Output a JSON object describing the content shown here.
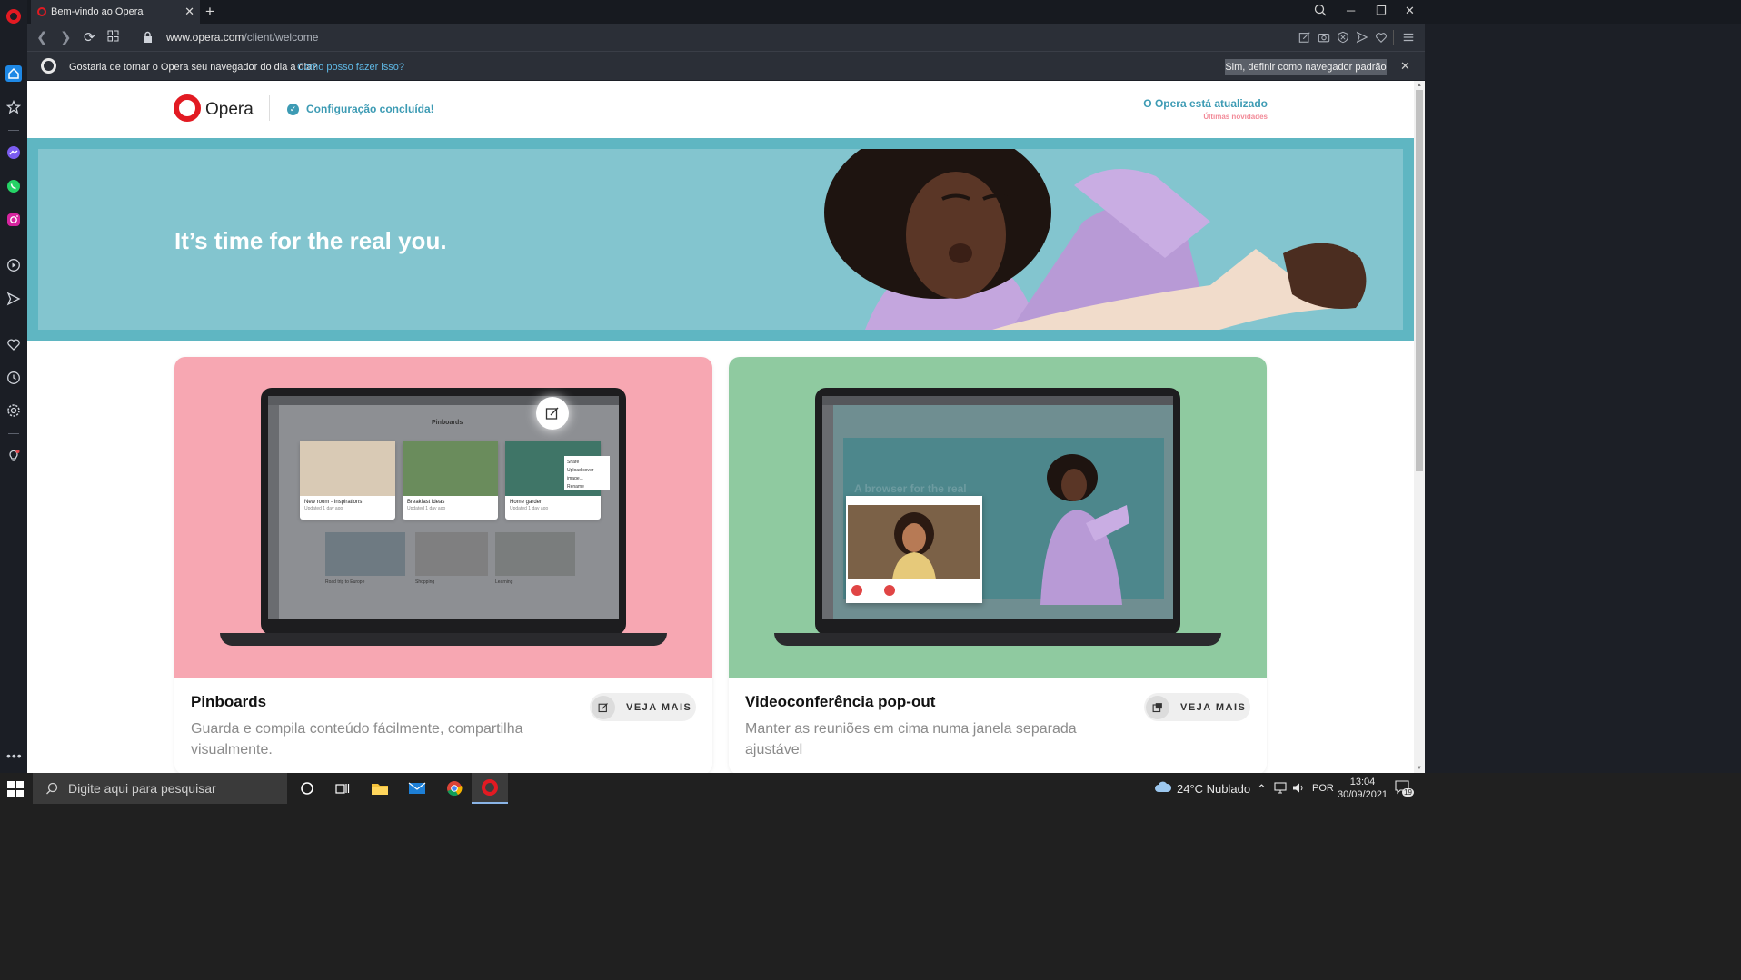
{
  "browser": {
    "tab_title": "Bem-vindo ao Opera",
    "url_host": "www.opera.com",
    "url_path": "/client/welcome"
  },
  "infobar": {
    "message": "Gostaria de tornar o Opera seu navegador do dia a dia?",
    "link": "Como posso fazer isso?",
    "button": "Sim, definir como navegador padrão"
  },
  "page": {
    "logo_text": "Opera",
    "config_status": "Configuração concluída!",
    "update_status": "O Opera está atualizado",
    "news_link": "Últimas novidades",
    "hero_title": "It’s time for the real you."
  },
  "cards": [
    {
      "title": "Pinboards",
      "description": "Guarda e compila conteúdo fácilmente, compartilha visualmente.",
      "button": "VEJA MAIS",
      "bg": "#f7a7b2",
      "screen_title": "Pinboards",
      "screen_items": [
        {
          "title": "New room - Inspirations",
          "sub": "Updated 1 day ago"
        },
        {
          "title": "Breakfast ideas",
          "sub": "Updated 1 day ago"
        },
        {
          "title": "Home garden",
          "sub": "Updated 1 day ago"
        }
      ],
      "menu_items": [
        "Share",
        "Upload cover image...",
        "Rename"
      ],
      "lower_items": [
        "Road trip to Europe",
        "Shopping",
        "Learning"
      ]
    },
    {
      "title": "Videoconferência pop-out",
      "description": "Manter as reuniões em cima numa janela separada ajustável",
      "button": "VEJA MAIS",
      "bg": "#8fcaa0",
      "screen_headline": "A browser for the real"
    }
  ],
  "taskbar": {
    "search_placeholder": "Digite aqui para pesquisar",
    "weather": "24°C  Nublado",
    "language": "POR",
    "time": "13:04",
    "date": "30/09/2021",
    "notifications": "19"
  },
  "colors": {
    "opera_red": "#e21a22",
    "accent_teal": "#3d9bb4",
    "hero_bg": "#83c5cf"
  }
}
